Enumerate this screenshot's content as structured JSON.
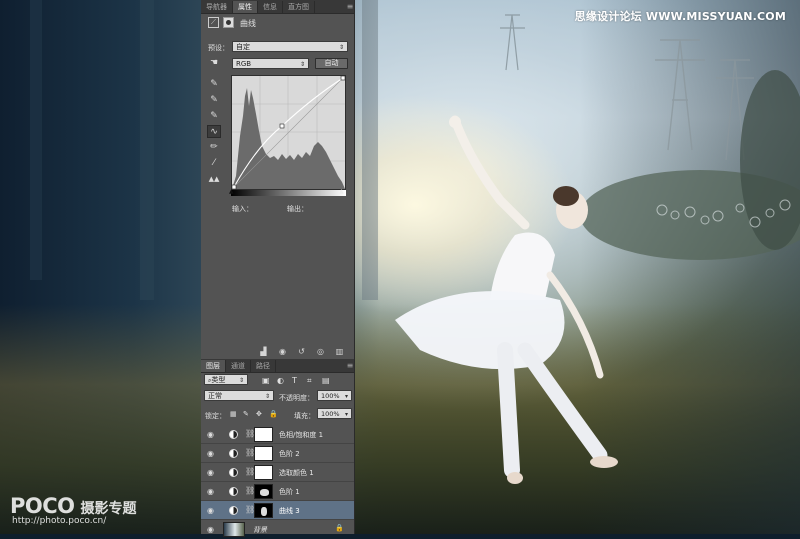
{
  "watermark": {
    "site": "思缘设计论坛 WWW.MISSYUAN.COM",
    "logo": "POCO",
    "logo_sub": "摄影专题",
    "url": "http://photo.poco.cn/"
  },
  "properties_panel": {
    "tabs": [
      "导航器",
      "属性",
      "信息",
      "直方图"
    ],
    "active_tab": "属性",
    "title": "曲线",
    "preset_label": "预设：",
    "preset_value": "自定",
    "channel_value": "RGB",
    "auto_button": "自动",
    "input_label": "输入：",
    "output_label": "输出："
  },
  "layers_panel": {
    "tabs": [
      "图层",
      "通道",
      "路径"
    ],
    "active_tab": "图层",
    "filter_value": "类型",
    "blend_mode": "正常",
    "opacity_label": "不透明度：",
    "opacity_value": "100%",
    "lock_label": "锁定：",
    "fill_label": "填充：",
    "fill_value": "100%",
    "layers": [
      {
        "name": "色相/饱和度 1",
        "selected": false
      },
      {
        "name": "色阶 2",
        "selected": false
      },
      {
        "name": "选取颜色 1",
        "selected": false
      },
      {
        "name": "色阶 1",
        "selected": false
      },
      {
        "name": "曲线 3",
        "selected": true
      }
    ],
    "background_layer": "背景"
  },
  "colors": {
    "panel_bg": "#535353",
    "selected_layer": "#5f7287"
  }
}
